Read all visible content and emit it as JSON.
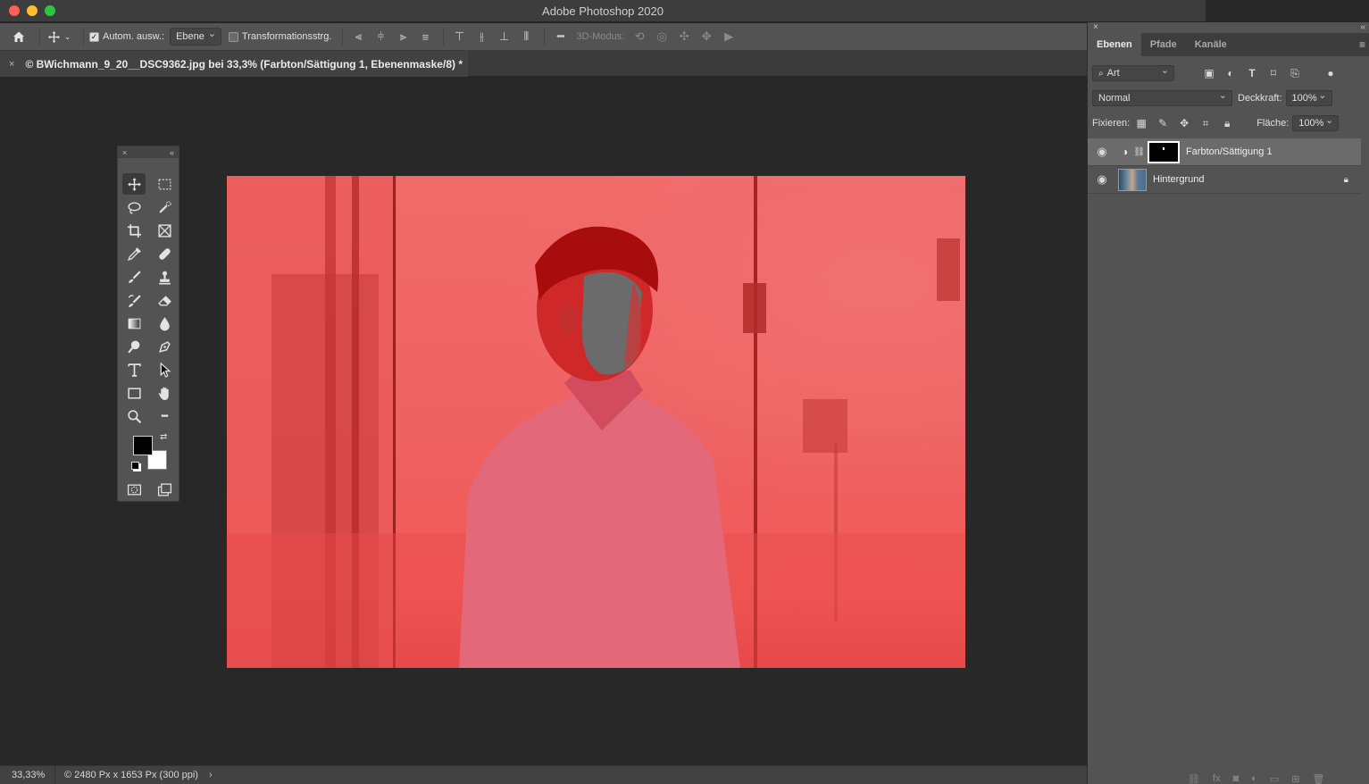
{
  "window": {
    "title": "Adobe Photoshop 2020",
    "traffic_lights": [
      "#fe5f57",
      "#febc2e",
      "#28c840"
    ]
  },
  "options_bar": {
    "auto_select_label": "Autom. ausw.:",
    "auto_select_checked": true,
    "auto_select_target": "Ebene",
    "transform_controls_label": "Transformationsstrg.",
    "transform_controls_checked": false,
    "three_d_mode_label": "3D-Modus:",
    "more_label": "•••"
  },
  "document_tab": {
    "close": "×",
    "title": "© BWichmann_9_20__DSC9362.jpg bei 33,3% (Farbton/Sättigung 1, Ebenenmaske/8) *"
  },
  "toolbox": {
    "close": "×",
    "collapse": "«",
    "more_tools": "•••",
    "foreground_color": "#000000",
    "background_color": "#ffffff"
  },
  "layers_panel": {
    "close": "×",
    "collapse": "«",
    "tabs": [
      {
        "label": "Ebenen",
        "active": true
      },
      {
        "label": "Pfade",
        "active": false
      },
      {
        "label": "Kanäle",
        "active": false
      }
    ],
    "menu_icon": "≡",
    "filter_kind": "Art",
    "blend_mode": "Normal",
    "opacity_label": "Deckkraft:",
    "opacity_value": "100%",
    "lock_label": "Fixieren:",
    "fill_label": "Fläche:",
    "fill_value": "100%",
    "layers": [
      {
        "name": "Farbton/Sättigung 1",
        "type": "adjustment",
        "visible": true,
        "selected": true
      },
      {
        "name": "Hintergrund",
        "type": "image",
        "visible": true,
        "selected": false,
        "locked": true
      }
    ]
  },
  "status_bar": {
    "zoom": "33,33%",
    "info": "© 2480 Px x 1653 Px (300 ppi)",
    "arrow": "›"
  },
  "colors": {
    "canvas_bg": "#282828",
    "panel_bg": "#535353",
    "overlay_red": "#f16a6a",
    "selected_layer": "#6b6b6b"
  }
}
